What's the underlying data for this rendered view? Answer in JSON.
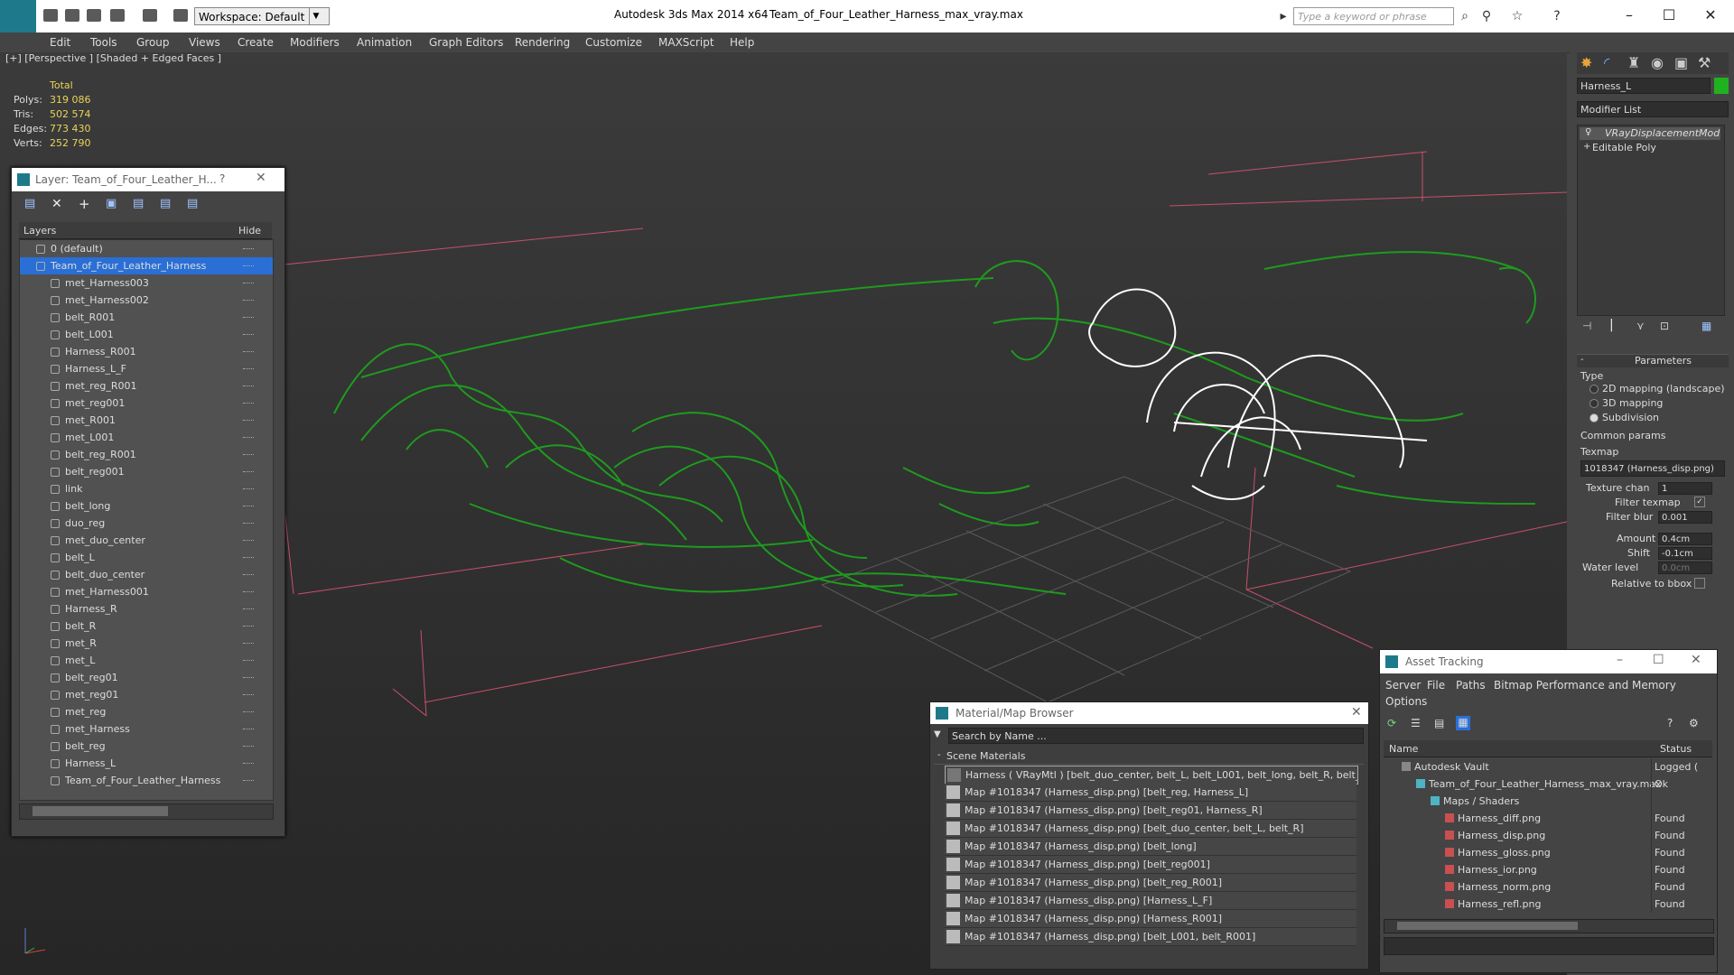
{
  "titlebar": {
    "workspace": "Workspace: Default",
    "app_title": "Autodesk 3ds Max  2014 x64",
    "file_title": "Team_of_Four_Leather_Harness_max_vray.max",
    "search_placeholder": "Type a keyword or phrase"
  },
  "menu": [
    "Edit",
    "Tools",
    "Group",
    "Views",
    "Create",
    "Modifiers",
    "Animation",
    "Graph Editors",
    "Rendering",
    "Customize",
    "MAXScript",
    "Help"
  ],
  "viewport": {
    "label": "[+] [Perspective ] [Shaded + Edged Faces ]",
    "stats": {
      "header": "Total",
      "rows": [
        {
          "label": "Polys:",
          "value": "319 086"
        },
        {
          "label": "Tris:",
          "value": "502 574"
        },
        {
          "label": "Edges:",
          "value": "773 430"
        },
        {
          "label": "Verts:",
          "value": "252 790"
        }
      ]
    },
    "wire_color": "#1e9b1e",
    "selected_wire_color": "#ffffff"
  },
  "layer_panel": {
    "title": "Layer: Team_of_Four_Leather_H...",
    "help": "?",
    "col_layers": "Layers",
    "col_hide": "Hide",
    "rows": [
      {
        "name": "0 (default)",
        "selected": false,
        "indent": 1
      },
      {
        "name": "Team_of_Four_Leather_Harness",
        "selected": true,
        "indent": 1
      },
      {
        "name": "met_Harness003"
      },
      {
        "name": "met_Harness002"
      },
      {
        "name": "belt_R001"
      },
      {
        "name": "belt_L001"
      },
      {
        "name": "Harness_R001"
      },
      {
        "name": "Harness_L_F"
      },
      {
        "name": "met_reg_R001"
      },
      {
        "name": "met_reg001"
      },
      {
        "name": "met_R001"
      },
      {
        "name": "met_L001"
      },
      {
        "name": "belt_reg_R001"
      },
      {
        "name": "belt_reg001"
      },
      {
        "name": "link"
      },
      {
        "name": "belt_long"
      },
      {
        "name": "duo_reg"
      },
      {
        "name": "met_duo_center"
      },
      {
        "name": "belt_L"
      },
      {
        "name": "belt_duo_center"
      },
      {
        "name": "met_Harness001"
      },
      {
        "name": "Harness_R"
      },
      {
        "name": "belt_R"
      },
      {
        "name": "met_R"
      },
      {
        "name": "met_L"
      },
      {
        "name": "belt_reg01"
      },
      {
        "name": "met_reg01"
      },
      {
        "name": "met_reg"
      },
      {
        "name": "met_Harness"
      },
      {
        "name": "belt_reg"
      },
      {
        "name": "Harness_L"
      },
      {
        "name": "Team_of_Four_Leather_Harness"
      }
    ],
    "selected_color": "#2a6fd6"
  },
  "command_panel": {
    "object_name": "Harness_L",
    "object_color": "#1fb21f",
    "modifier_list": "Modifier List",
    "stack": [
      "VRayDisplacementMod",
      "Editable Poly"
    ],
    "rollout_title": "Parameters",
    "type_label": "Type",
    "types": [
      {
        "label": "2D mapping (landscape)",
        "checked": false
      },
      {
        "label": "3D mapping",
        "checked": false
      },
      {
        "label": "Subdivision",
        "checked": true
      }
    ],
    "common_label": "Common params",
    "texmap_label": "Texmap",
    "texmap_value": "1018347 (Harness_disp.png)",
    "texture_chan_label": "Texture chan",
    "texture_chan_value": "1",
    "filter_texmap_label": "Filter texmap",
    "filter_blur_label": "Filter blur",
    "filter_blur_value": "0.001",
    "amount_label": "Amount",
    "amount_value": "0.4cm",
    "shift_label": "Shift",
    "shift_value": "-0.1cm",
    "water_label": "Water level",
    "water_value": "0.0cm",
    "relative_label": "Relative to bbox"
  },
  "material_browser": {
    "title": "Material/Map Browser",
    "search_placeholder": "Search by Name ...",
    "section": "Scene Materials",
    "rows": [
      "Harness ( VRayMtl ) [belt_duo_center, belt_L, belt_L001, belt_long, belt_R, belt_...",
      "Map #1018347 (Harness_disp.png) [belt_reg, Harness_L]",
      "Map #1018347 (Harness_disp.png) [belt_reg01, Harness_R]",
      "Map #1018347 (Harness_disp.png) [belt_duo_center, belt_L, belt_R]",
      "Map #1018347 (Harness_disp.png) [belt_long]",
      "Map #1018347 (Harness_disp.png) [belt_reg001]",
      "Map #1018347 (Harness_disp.png) [belt_reg_R001]",
      "Map #1018347 (Harness_disp.png) [Harness_L_F]",
      "Map #1018347 (Harness_disp.png) [Harness_R001]",
      "Map #1018347 (Harness_disp.png) [belt_L001, belt_R001]"
    ]
  },
  "asset_tracking": {
    "title": "Asset Tracking",
    "menu": [
      "Server",
      "File",
      "Paths",
      "Bitmap Performance and Memory"
    ],
    "menu2": "Options",
    "col_name": "Name",
    "col_status": "Status",
    "rows": [
      {
        "name": "Autodesk Vault",
        "status": "Logged (",
        "indent": 0
      },
      {
        "name": "Team_of_Four_Leather_Harness_max_vray.max",
        "status": "Ok",
        "indent": 1
      },
      {
        "name": "Maps / Shaders",
        "status": "",
        "indent": 2
      },
      {
        "name": "Harness_diff.png",
        "status": "Found",
        "indent": 3
      },
      {
        "name": "Harness_disp.png",
        "status": "Found",
        "indent": 3
      },
      {
        "name": "Harness_gloss.png",
        "status": "Found",
        "indent": 3
      },
      {
        "name": "Harness_ior.png",
        "status": "Found",
        "indent": 3
      },
      {
        "name": "Harness_norm.png",
        "status": "Found",
        "indent": 3
      },
      {
        "name": "Harness_refl.png",
        "status": "Found",
        "indent": 3
      }
    ]
  }
}
